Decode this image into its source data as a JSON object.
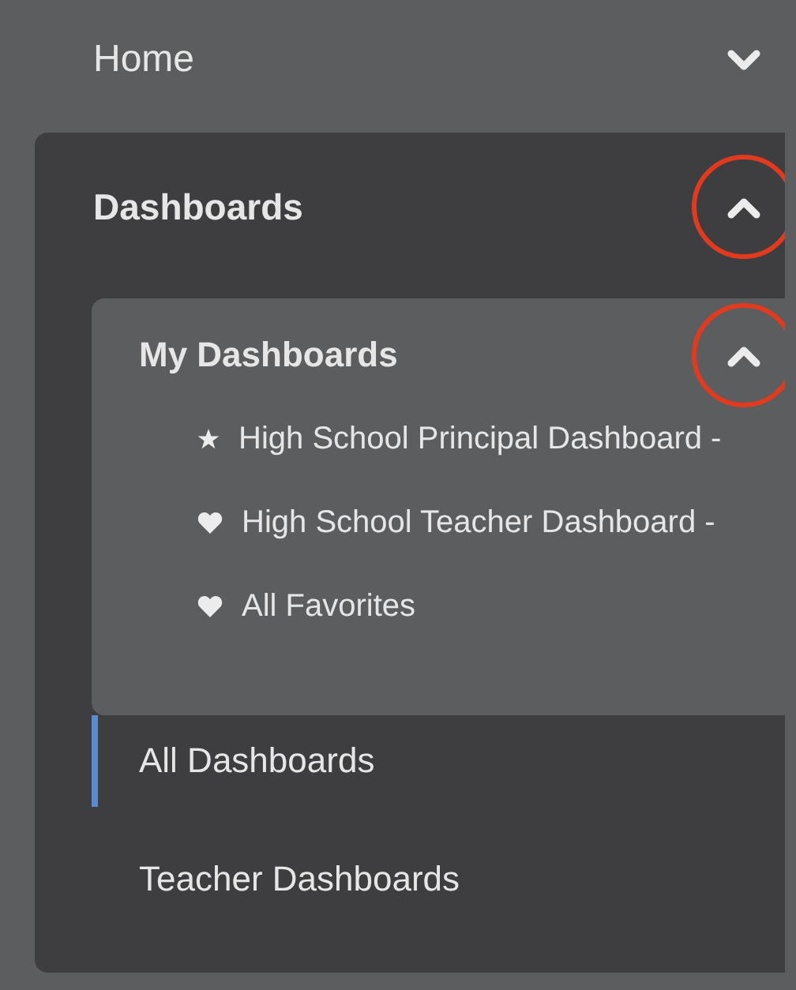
{
  "nav": [
    {
      "label": "Home",
      "expanded": false,
      "highlighted": false
    },
    {
      "label": "Dashboards",
      "expanded": true,
      "highlighted": true,
      "group": {
        "label": "My Dashboards",
        "expanded": true,
        "highlighted": true,
        "items": [
          {
            "label": "High School Principal Dashboard -",
            "kind": "pinned"
          },
          {
            "label": "High School Teacher Dashboard -",
            "kind": "favorite"
          },
          {
            "label": "All Favorites",
            "kind": "favorite"
          }
        ]
      },
      "links": [
        {
          "label": "All Dashboards",
          "selected": true
        },
        {
          "label": "Teacher Dashboards",
          "selected": false
        }
      ]
    }
  ]
}
